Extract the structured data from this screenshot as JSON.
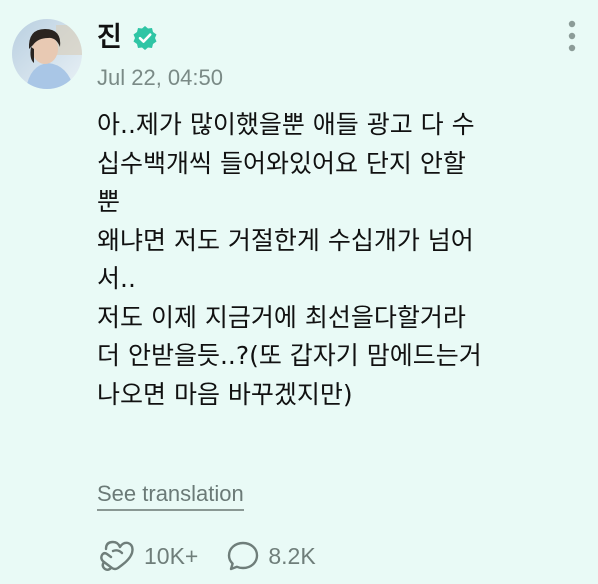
{
  "post": {
    "author": "진",
    "timestamp": "Jul 22, 04:50",
    "lines": [
      "아..제가 많이했을뿐 애들 광고 다 수",
      "십수백개씩 들어와있어요 단지 안할",
      "뿐",
      "왜냐면 저도 거절한게 수십개가 넘어",
      "서..",
      "저도 이제 지금거에 최선을다할거라",
      "더 안받을듯..?(또 갑자기 맘에드는거",
      "나오면 마음 바꾸겠지만)"
    ],
    "translate_label": "See translation"
  },
  "actions": {
    "likes": "10K+",
    "comments": "8.2K"
  },
  "icons": {
    "verified": "verified-badge-icon",
    "more": "more-vertical-icon",
    "like": "heart-hands-icon",
    "comment": "speech-bubble-icon"
  },
  "colors": {
    "background": "#e9faf6",
    "verified": "#2fc5a5",
    "muted": "#7a8a86"
  }
}
